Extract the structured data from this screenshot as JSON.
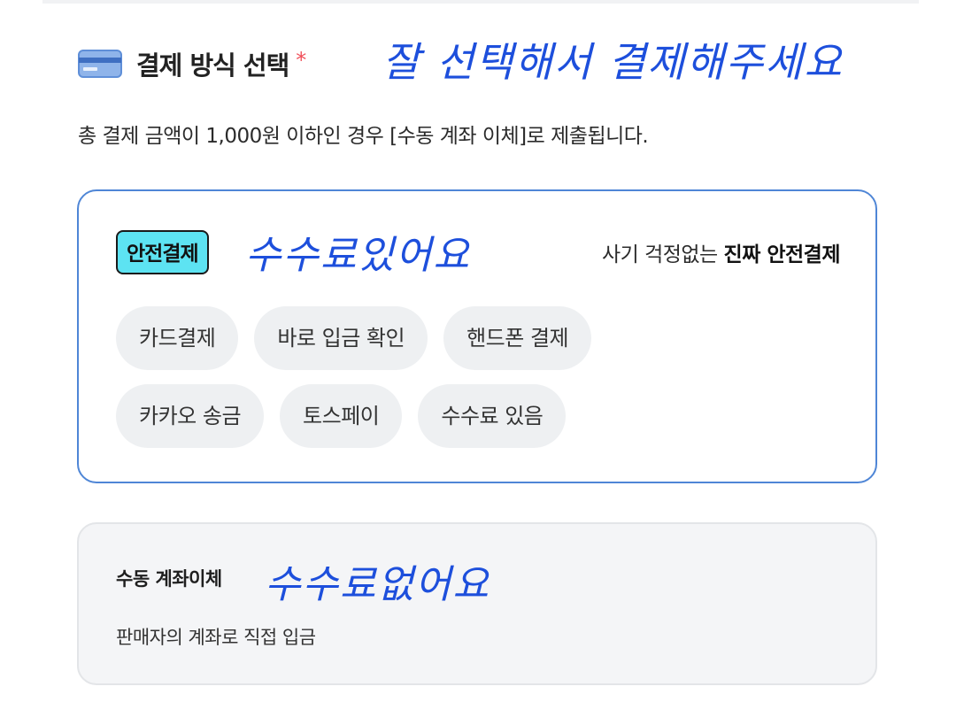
{
  "header": {
    "title": "결제 방식 선택",
    "required_mark": "*",
    "handwritten_note": "잘 선택해서 결제해주세요",
    "icon": "credit-card-icon"
  },
  "notice": "총 결제 금액이 1,000원 이하인 경우 [수동 계좌 이체]로 제출됩니다.",
  "safe_payment": {
    "badge": "안전결제",
    "handwritten_note": "수수료있어요",
    "tagline_prefix": "사기 걱정없는 ",
    "tagline_bold": "진짜 안전결제",
    "chips_row1": [
      "카드결제",
      "바로 입금 확인",
      "핸드폰 결제"
    ],
    "chips_row2": [
      "카카오 송금",
      "토스페이",
      "수수료 있음"
    ],
    "border_color": "#4f86d6",
    "badge_color": "#5de3f2"
  },
  "manual_transfer": {
    "title": "수동 계좌이체",
    "handwritten_note": "수수료없어요",
    "description": "판매자의 계좌로 직접 입금"
  },
  "colors": {
    "handwriting": "#1d4fdc",
    "required": "#f0505a"
  }
}
